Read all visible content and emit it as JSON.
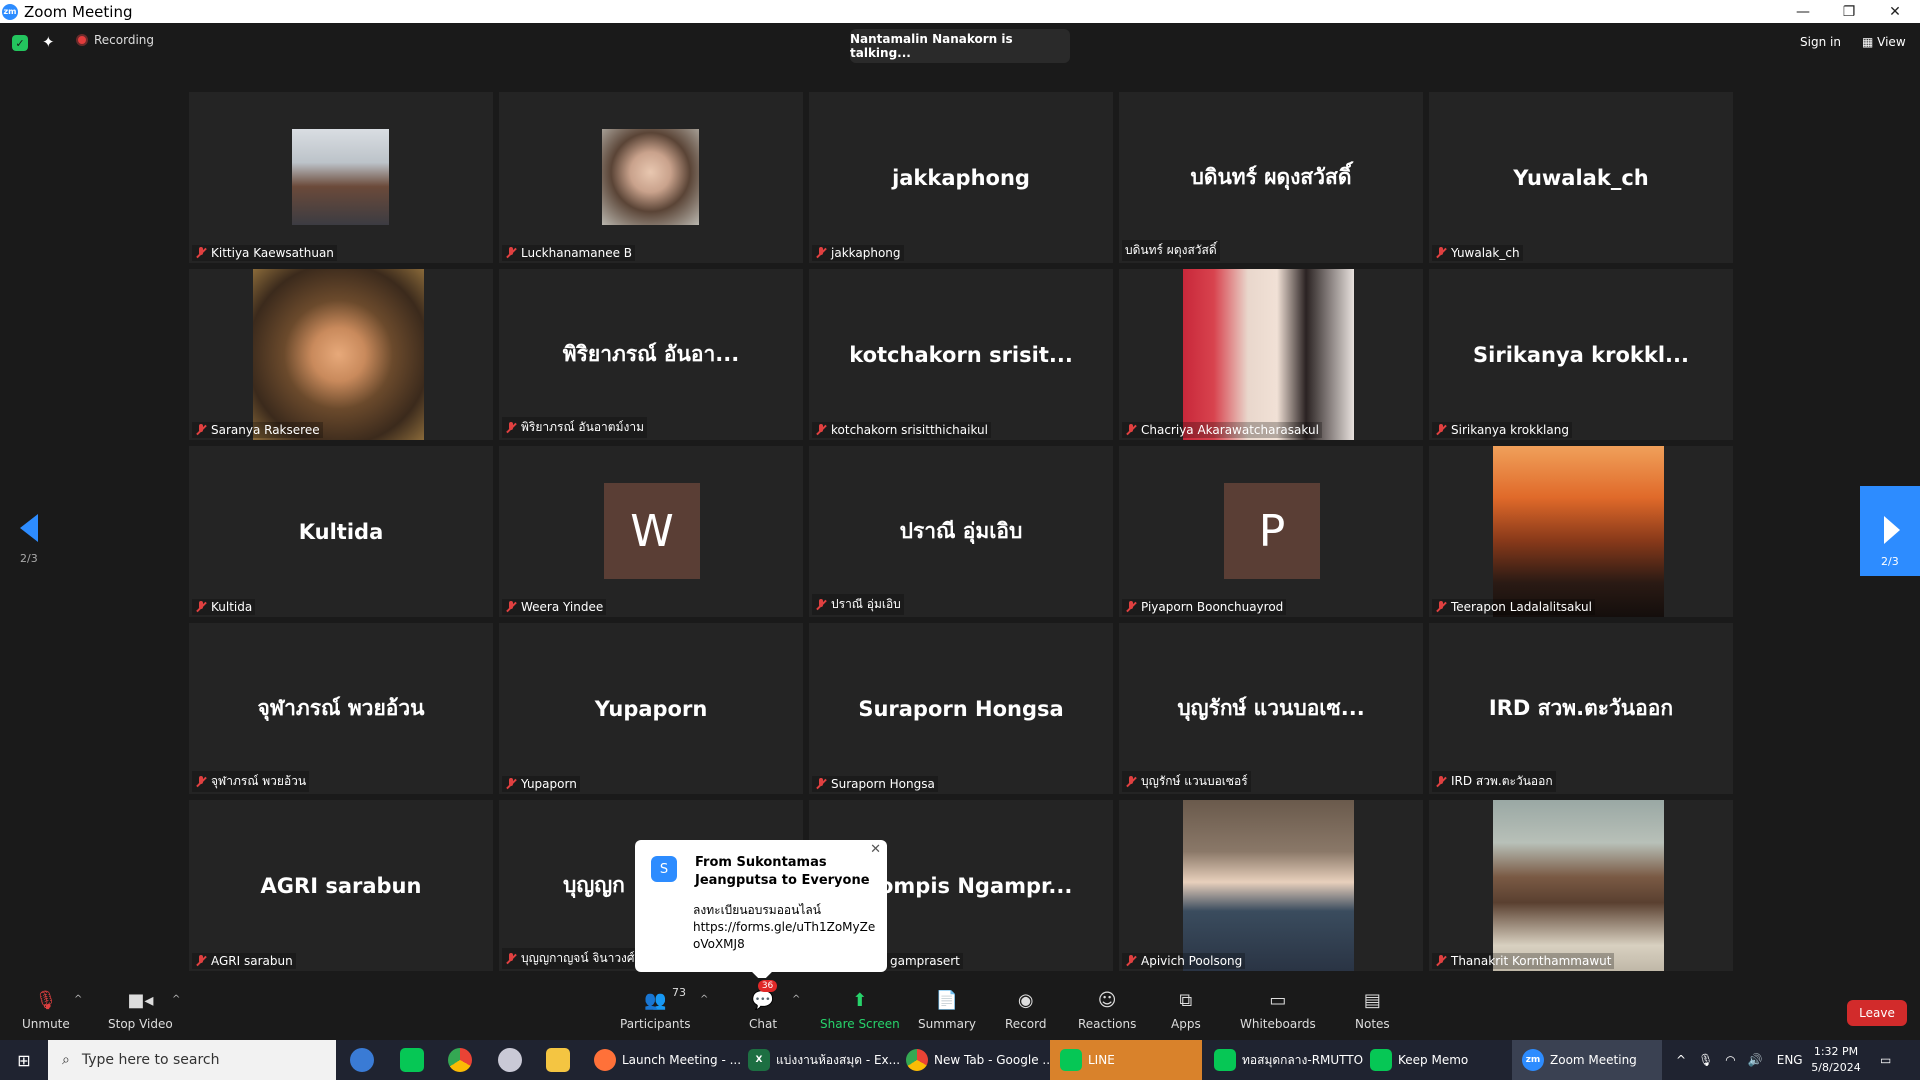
{
  "window": {
    "title": "Zoom Meeting",
    "minimize": "—",
    "restore": "❐",
    "close": "✕"
  },
  "topbar": {
    "recording_label": "Recording",
    "talking": "Nantamalin Nanakorn is talking...",
    "sign_in": "Sign in",
    "view": "View"
  },
  "gallery": {
    "page_indicator_left": "2/3",
    "page_indicator_right": "2/3",
    "tiles": [
      {
        "center": "",
        "label": "Kittiya Kaewsathuan",
        "muted": true
      },
      {
        "center": "",
        "label": "Luckhanamanee B",
        "muted": true
      },
      {
        "center": "jakkaphong",
        "label": "jakkaphong",
        "muted": true
      },
      {
        "center": "บดินทร์ ผดุงสวัสดิ์",
        "label": "บดินทร์ ผดุงสวัสดิ์",
        "muted": false
      },
      {
        "center": "Yuwalak_ch",
        "label": "Yuwalak_ch",
        "muted": true
      },
      {
        "center": "",
        "label": "Saranya Rakseree",
        "muted": true
      },
      {
        "center": "พิริยาภรณ์  อันอา...",
        "label": "พิริยาภรณ์  อันอาตม์งาม",
        "muted": true
      },
      {
        "center": "kotchakorn  srisit...",
        "label": "kotchakorn srisitthichaikul",
        "muted": true
      },
      {
        "center": "",
        "label": "Chacriya Akarawatcharasakul",
        "muted": true
      },
      {
        "center": "Sirikanya  krokkl...",
        "label": "Sirikanya krokklang",
        "muted": true
      },
      {
        "center": "Kultida",
        "label": "Kultida",
        "muted": true
      },
      {
        "center": "",
        "label": "Weera Yindee",
        "muted": true,
        "letter": "W"
      },
      {
        "center": "ปราณี  อุ่มเอิบ",
        "label": "ปราณี  อุ่มเอิบ",
        "muted": true
      },
      {
        "center": "",
        "label": "Piyaporn Boonchuayrod",
        "muted": true,
        "letter": "P"
      },
      {
        "center": "",
        "label": "Teerapon Ladalalitsakul",
        "muted": true
      },
      {
        "center": "จุฬาภรณ์  พวยอ้วน",
        "label": "จุฬาภรณ์  พวยอ้วน",
        "muted": true
      },
      {
        "center": "Yupaporn",
        "label": "Yupaporn",
        "muted": true
      },
      {
        "center": "Suraporn Hongsa",
        "label": "Suraporn Hongsa",
        "muted": true
      },
      {
        "center": "บุญรักษ์ แวนบอเซ...",
        "label": "บุญรักษ์ แวนบอเซอร์",
        "muted": true
      },
      {
        "center": "IRD สวพ.ตะวันออก",
        "label": "IRD สวพ.ตะวันออก",
        "muted": true
      },
      {
        "center": "AGRI sarabun",
        "label": "AGRI sarabun",
        "muted": true
      },
      {
        "center": "บุญญก",
        "label": "บุญญกาญจน์ จินาวงศ์",
        "muted": true
      },
      {
        "center": "ompis  Ngampr...",
        "label": "gamprasert",
        "muted": false
      },
      {
        "center": "",
        "label": "Apivich Poolsong",
        "muted": true
      },
      {
        "center": "",
        "label": "Thanakrit Kornthammawut",
        "muted": true
      }
    ]
  },
  "chat_popup": {
    "avatar_letter": "S",
    "from": "From Sukontamas Jeangputsa to Everyone",
    "message_line1": "ลงทะเบียนอบรมออนไลน์",
    "message_line2": "https://forms.gle/uTh1ZoMyZeoVoXMJ8",
    "close": "✕"
  },
  "toolbar": {
    "unmute": "Unmute",
    "stop_video": "Stop Video",
    "participants": "Participants",
    "participant_count": "73",
    "chat": "Chat",
    "chat_badge": "36",
    "share_screen": "Share Screen",
    "summary": "Summary",
    "record": "Record",
    "reactions": "Reactions",
    "apps": "Apps",
    "whiteboards": "Whiteboards",
    "notes": "Notes",
    "leave": "Leave"
  },
  "taskbar": {
    "search_placeholder": "Type here to search",
    "apps": [
      {
        "label": "Launch Meeting - ..."
      },
      {
        "label": "แบ่งงานห้องสมุด - Ex..."
      },
      {
        "label": "New Tab - Google ..."
      },
      {
        "label": "LINE"
      },
      {
        "label": "ทอสมุดกลาง-RMUTTO"
      },
      {
        "label": "Keep Memo"
      },
      {
        "label": "Zoom Meeting"
      }
    ],
    "lang": "ENG",
    "time": "1:32 PM",
    "date": "5/8/2024"
  },
  "colors": {
    "accent": "#2d8cff",
    "leave": "#d22b2b",
    "share_green": "#27d36b",
    "tile_bg": "#242424",
    "app_bg": "#1a1a1a"
  }
}
